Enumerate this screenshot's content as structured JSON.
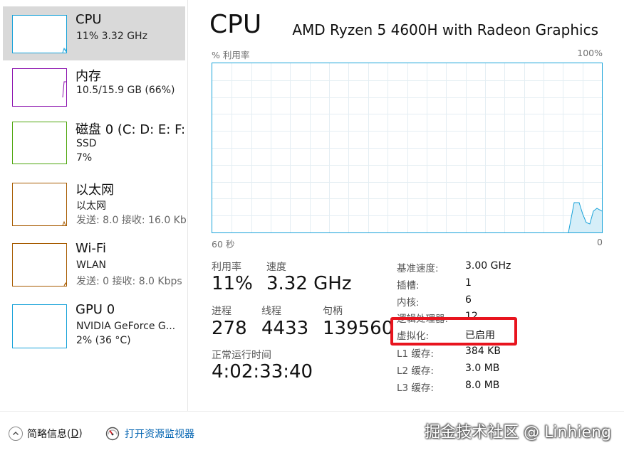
{
  "sidebar": {
    "items": [
      {
        "title": "CPU",
        "line1": "11% 3.32 GHz",
        "line2": "",
        "color": "#17a2d9",
        "selected": true
      },
      {
        "title": "内存",
        "line1": "10.5/15.9 GB (66%)",
        "line2": "",
        "color": "#8b12ae"
      },
      {
        "title": "磁盘 0 (C: D: E: F:",
        "line1": "SSD",
        "line2": "7%",
        "color": "#4da60c"
      },
      {
        "title": "以太网",
        "line1": "以太网",
        "line2": "发送: 8.0 接收: 16.0 Kb",
        "color": "#a75b00"
      },
      {
        "title": "Wi-Fi",
        "line1": "WLAN",
        "line2": "发送: 0 接收: 8.0 Kbps",
        "color": "#a75b00"
      },
      {
        "title": "GPU 0",
        "line1": "NVIDIA GeForce G...",
        "line2": "2% (36 °C)",
        "color": "#17a2d9"
      }
    ]
  },
  "main": {
    "title": "CPU",
    "model": "AMD Ryzen 5 4600H with Radeon Graphics",
    "graph": {
      "top_left_label": "% 利用率",
      "top_right_label": "100%",
      "bottom_left_label": "60 秒",
      "bottom_right_label": "0",
      "color": "#17a2d9"
    },
    "stats": {
      "utilization": {
        "label": "利用率",
        "value": "11%"
      },
      "speed": {
        "label": "速度",
        "value": "3.32 GHz"
      },
      "processes": {
        "label": "进程",
        "value": "278"
      },
      "threads": {
        "label": "线程",
        "value": "4433"
      },
      "handles": {
        "label": "句柄",
        "value": "139560"
      },
      "uptime": {
        "label": "正常运行时间",
        "value": "4:02:33:40"
      }
    },
    "specs": [
      {
        "key": "基准速度:",
        "value": "3.00 GHz"
      },
      {
        "key": "插槽:",
        "value": "1"
      },
      {
        "key": "内核:",
        "value": "6"
      },
      {
        "key": "逻辑处理器:",
        "value": "12"
      },
      {
        "key": "虚拟化:",
        "value": "已启用"
      },
      {
        "key": "L1 缓存:",
        "value": "384 KB"
      },
      {
        "key": "L2 缓存:",
        "value": "3.0 MB"
      },
      {
        "key": "L3 缓存:",
        "value": "8.0 MB"
      }
    ],
    "highlight_color": "#e8141e"
  },
  "footer": {
    "brief_label": "简略信息(",
    "brief_key": "D",
    "brief_close": ")",
    "resource_monitor_label": "打开资源监视器",
    "watermark": "掘金技术社区 @ Linhieng"
  }
}
